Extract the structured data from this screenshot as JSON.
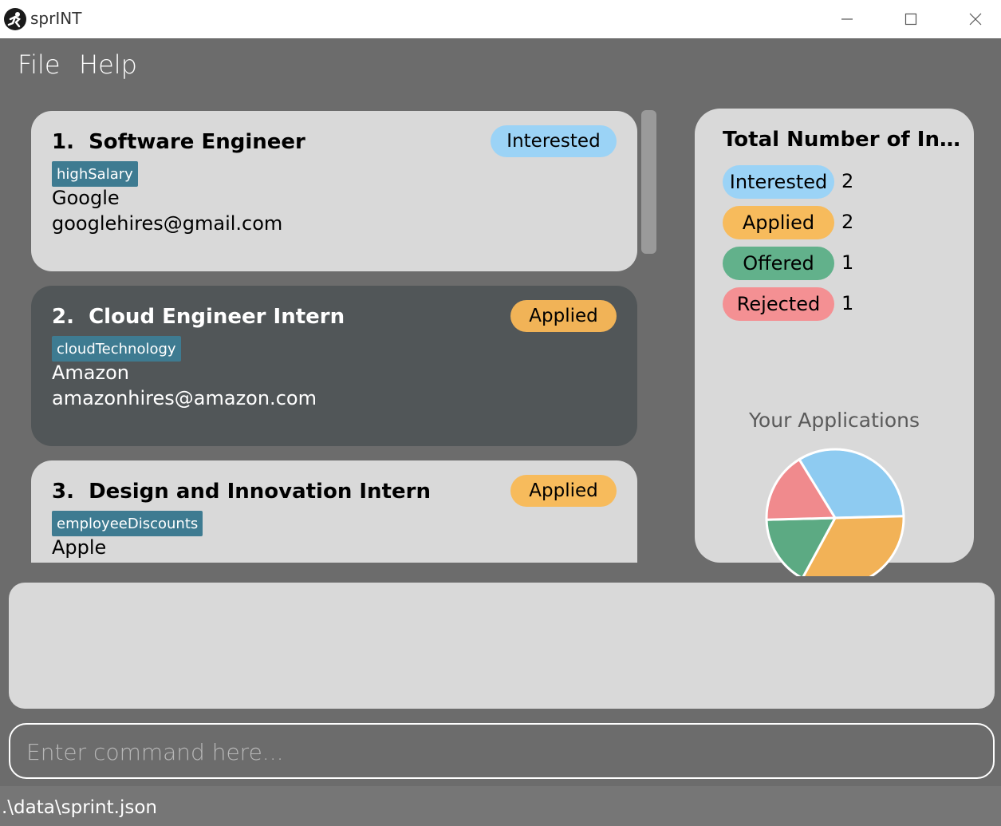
{
  "window": {
    "title": "sprINT",
    "minimize_icon": "minimize-icon",
    "maximize_icon": "maximize-icon",
    "close_icon": "close-icon"
  },
  "menu": {
    "file": "File",
    "help": "Help"
  },
  "applications": [
    {
      "index": "1.",
      "role": "Software Engineer",
      "status": "Interested",
      "tag": "highSalary",
      "company": "Google",
      "email": "googlehires@gmail.com"
    },
    {
      "index": "2.",
      "role": "Cloud Engineer Intern",
      "status": "Applied",
      "tag": "cloudTechnology",
      "company": "Amazon",
      "email": "amazonhires@amazon.com"
    },
    {
      "index": "3.",
      "role": "Design and Innovation Intern",
      "status": "Applied",
      "tag": "employeeDiscounts",
      "company": "Apple",
      "email": ""
    }
  ],
  "statistics": {
    "title": "Total Number of Internships",
    "rows": [
      {
        "label": "Interested",
        "count": "2",
        "color": "#9bd3f6"
      },
      {
        "label": "Applied",
        "count": "2",
        "color": "#f7bb5c"
      },
      {
        "label": "Offered",
        "count": "1",
        "color": "#62b18b"
      },
      {
        "label": "Rejected",
        "count": "1",
        "color": "#f49093"
      }
    ],
    "chart_title": "Your Applications"
  },
  "chart_data": {
    "type": "pie",
    "title": "Your Applications",
    "categories": [
      "Interested",
      "Applied",
      "Offered",
      "Rejected"
    ],
    "values": [
      2,
      2,
      1,
      1
    ],
    "colors": [
      "#8ecbf1",
      "#f2b257",
      "#5caa83",
      "#f08a8d"
    ]
  },
  "command": {
    "placeholder": "Enter command here..."
  },
  "status_bar": {
    "path": ".\\data\\sprint.json"
  }
}
